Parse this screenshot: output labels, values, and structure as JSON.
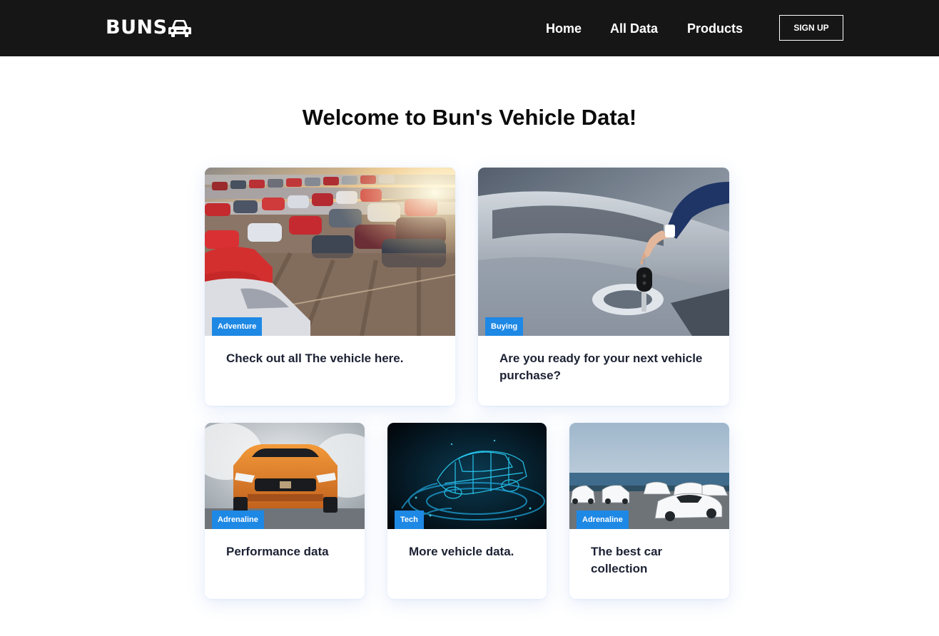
{
  "nav": {
    "logo_text": "BUNS",
    "logo_icon": "car-icon",
    "links": [
      "Home",
      "All Data",
      "Products"
    ],
    "signup_label": "SIGN UP"
  },
  "main": {
    "title": "Welcome to Bun's Vehicle Data!",
    "cards": [
      {
        "tag": "Adventure",
        "title": "Check out all The vehicle here.",
        "image": "car-lot-photo"
      },
      {
        "tag": "Buying",
        "title": "Are you ready for your next vehicle purchase?",
        "image": "car-key-handover-photo"
      },
      {
        "tag": "Adrenaline",
        "title": "Performance data",
        "image": "orange-muscle-car-photo"
      },
      {
        "tag": "Tech",
        "title": "More vehicle data.",
        "image": "holographic-car-photo"
      },
      {
        "tag": "Adrenaline",
        "title": "The best car collection",
        "image": "white-supercars-seaside-photo"
      }
    ]
  },
  "colors": {
    "navbar_bg": "#161616",
    "tag_bg": "#1e88e5",
    "title_text": "#1c2233"
  }
}
